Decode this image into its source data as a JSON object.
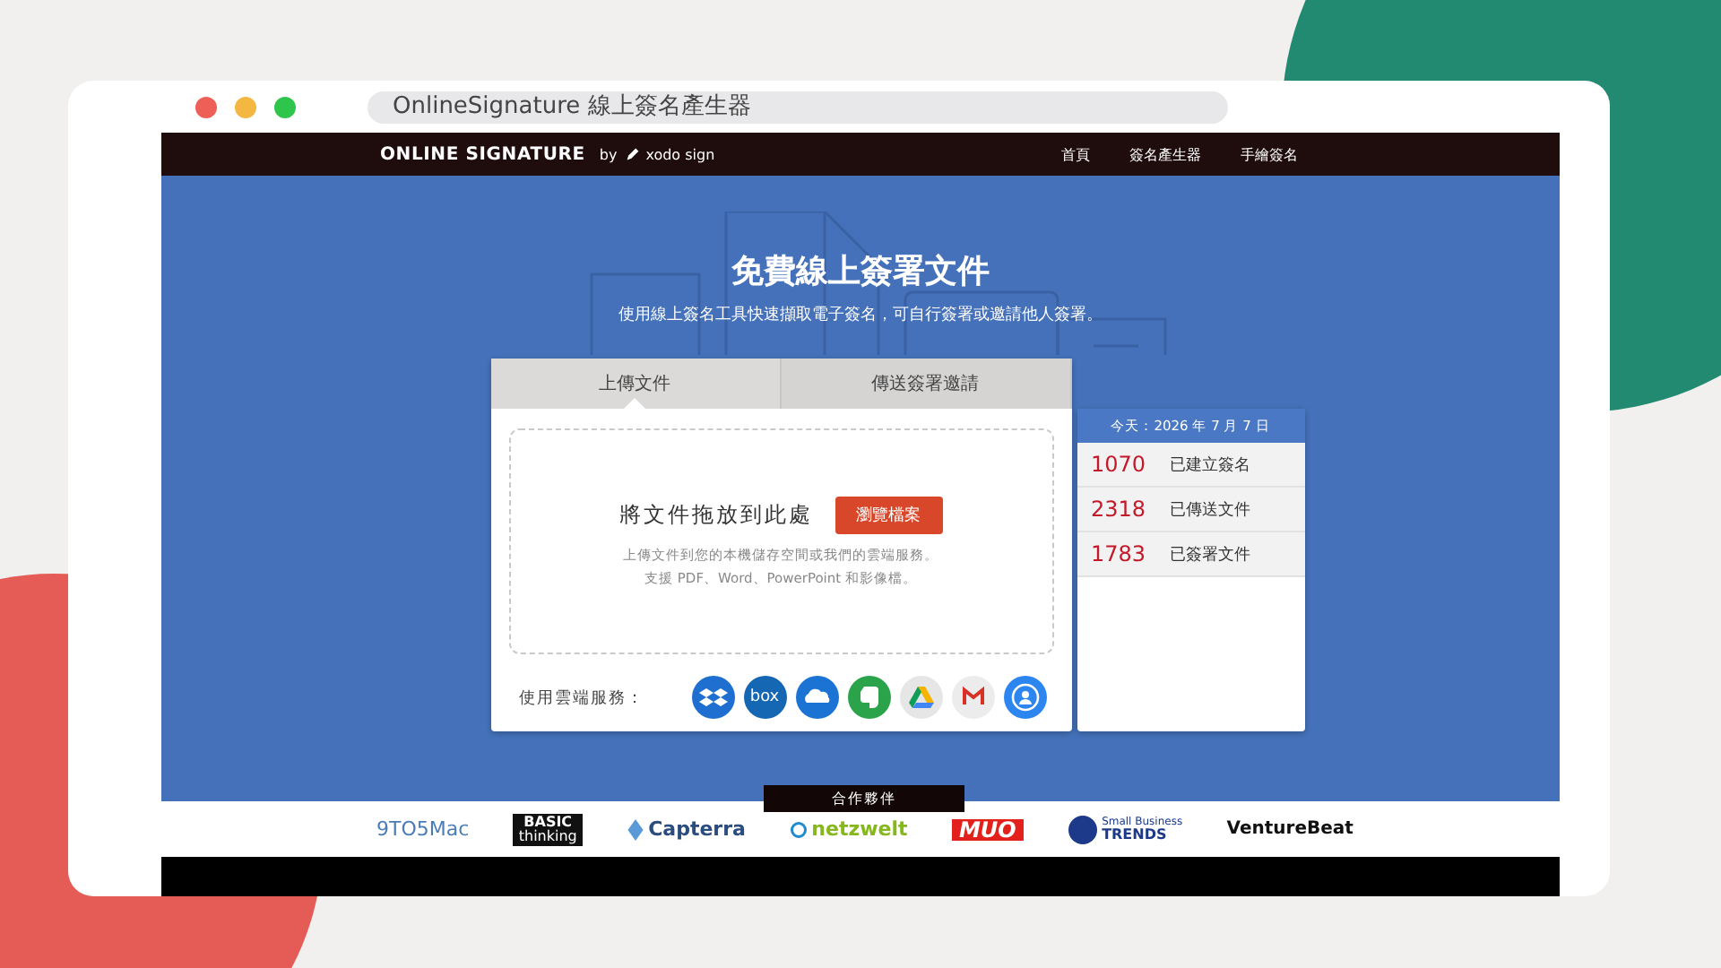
{
  "browser": {
    "address": "OnlineSignature 線上簽名產生器"
  },
  "nav": {
    "brand": "ONLINE SIGNATURE",
    "by": "by",
    "partner": "xodo sign",
    "links": [
      {
        "label": "首頁"
      },
      {
        "label": "簽名產生器"
      },
      {
        "label": "手繪簽名"
      }
    ]
  },
  "hero": {
    "title": "免費線上簽署文件",
    "subtitle": "使用線上簽名工具快速擷取電子簽名，可自行簽署或邀請他人簽署。"
  },
  "tabs": [
    {
      "label": "上傳文件",
      "selected": true
    },
    {
      "label": "傳送簽署邀請",
      "selected": false
    }
  ],
  "dropzone": {
    "prompt": "將文件拖放到此處",
    "button": "瀏覽檔案",
    "hint_lines": [
      "上傳文件到您的本機儲存空間或我們的雲端服務。",
      "支援 PDF、Word、PowerPoint 和影像檔。"
    ]
  },
  "cloud": {
    "label": "使用雲端服務：",
    "services": [
      {
        "kind": "dropbox"
      },
      {
        "kind": "box",
        "text": "box"
      },
      {
        "kind": "onedrive"
      },
      {
        "kind": "evernote"
      },
      {
        "kind": "drive"
      },
      {
        "kind": "gmail"
      },
      {
        "kind": "link"
      }
    ]
  },
  "stats": {
    "date": "今天：2026 年 7 月 7 日",
    "rows": [
      {
        "count": "1070",
        "label": "已建立簽名"
      },
      {
        "count": "2318",
        "label": "已傳送文件"
      },
      {
        "count": "1783",
        "label": "已簽署文件"
      }
    ]
  },
  "partners": {
    "title": "合作夥伴",
    "logos": [
      {
        "kind": "thin",
        "lines": [
          "9TO5Mac"
        ]
      },
      {
        "kind": "boxed",
        "lines": [
          "BASIC",
          "thinking"
        ]
      },
      {
        "kind": "capterra",
        "lines": [
          "Capterra"
        ]
      },
      {
        "kind": "netzwelt",
        "lines": [
          "netzwelt"
        ]
      },
      {
        "kind": "red",
        "lines": [
          "MUO"
        ]
      },
      {
        "kind": "trends",
        "lines": [
          "Small Business",
          "TRENDS"
        ]
      },
      {
        "kind": "bold",
        "lines": [
          "VentureBeat"
        ]
      }
    ]
  }
}
